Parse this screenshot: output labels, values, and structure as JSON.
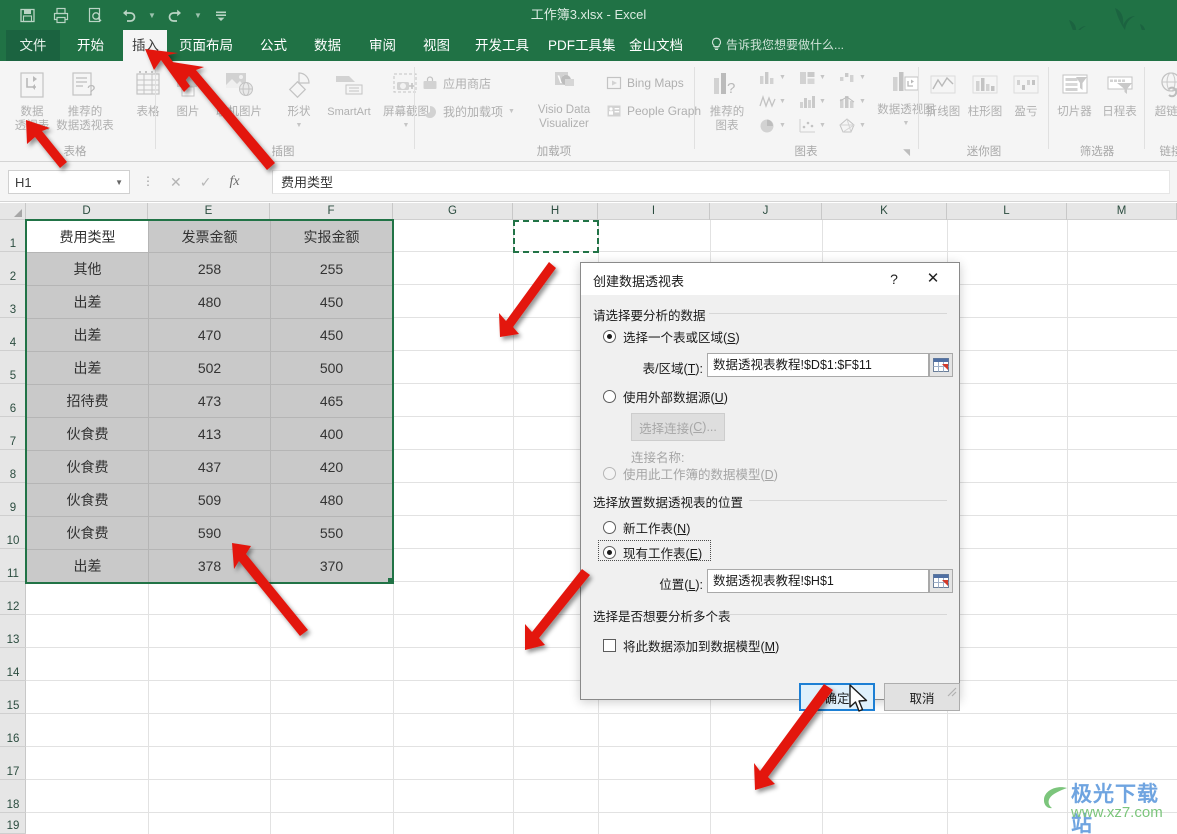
{
  "titlebar": {
    "document_title": "工作簿3.xlsx - Excel",
    "qat": [
      {
        "name": "save-icon",
        "label": "保存"
      },
      {
        "name": "print-icon",
        "label": "快速打印"
      },
      {
        "name": "print-preview-icon",
        "label": "打印预览"
      },
      {
        "name": "undo-icon",
        "label": "撤销"
      },
      {
        "name": "redo-icon",
        "label": "恢复"
      },
      {
        "name": "customize-qat-icon",
        "label": "自定义快速访问工具栏"
      }
    ]
  },
  "tabs": [
    {
      "label": "文件",
      "state": "file"
    },
    {
      "label": "开始",
      "state": "normal"
    },
    {
      "label": "插入",
      "state": "active"
    },
    {
      "label": "页面布局",
      "state": "normal"
    },
    {
      "label": "公式",
      "state": "normal"
    },
    {
      "label": "数据",
      "state": "normal"
    },
    {
      "label": "审阅",
      "state": "normal"
    },
    {
      "label": "视图",
      "state": "normal"
    },
    {
      "label": "开发工具",
      "state": "normal"
    },
    {
      "label": "PDF工具集",
      "state": "normal"
    },
    {
      "label": "金山文档",
      "state": "normal"
    }
  ],
  "tellme": {
    "text": "告诉我您想要做什么..."
  },
  "ribbon": {
    "groups": [
      {
        "title": "表格",
        "items": [
          {
            "label": "数据\n透视表",
            "line1": "数据",
            "line2": "透视表",
            "icon": "pivot-table-icon"
          },
          {
            "label": "推荐的\n数据透视表",
            "line1": "推荐的",
            "line2": "数据透视表",
            "icon": "recommended-pivot-icon"
          },
          {
            "label": "表格",
            "line1": "表格",
            "line2": "",
            "icon": "table-icon"
          }
        ]
      },
      {
        "title": "插图",
        "items": [
          {
            "line1": "图片",
            "line2": "",
            "icon": "picture-icon"
          },
          {
            "line1": "联机图片",
            "line2": "",
            "icon": "online-picture-icon"
          },
          {
            "line1": "形状",
            "line2": "",
            "icon": "shapes-icon"
          },
          {
            "line1": "SmartArt",
            "line2": "",
            "icon": "smartart-icon"
          },
          {
            "line1": "屏幕截图",
            "line2": "",
            "icon": "screenshot-icon"
          }
        ]
      },
      {
        "title": "加载项",
        "items": [
          {
            "line1": "应用商店",
            "icon": "store-icon"
          },
          {
            "line1": "我的加载项",
            "icon": "my-addins-icon"
          },
          {
            "line1": "Visio Data Visualizer",
            "icon": "visio-icon"
          },
          {
            "line1": "Bing Maps",
            "icon": "bing-maps-icon"
          },
          {
            "line1": "People Graph",
            "icon": "people-graph-icon"
          }
        ]
      },
      {
        "title": "图表",
        "items": [
          {
            "line1": "推荐的",
            "line2": "图表",
            "icon": "recommended-charts-icon"
          },
          {
            "line1": "数据透视图",
            "line2": "",
            "icon": "pivot-chart-icon"
          }
        ]
      },
      {
        "title": "迷你图",
        "items": [
          {
            "line1": "折线图",
            "icon": "sparkline-line-icon"
          },
          {
            "line1": "柱形图",
            "icon": "sparkline-column-icon"
          },
          {
            "line1": "盈亏",
            "icon": "sparkline-winloss-icon"
          }
        ]
      },
      {
        "title": "筛选器",
        "items": [
          {
            "line1": "切片器",
            "icon": "slicer-icon"
          },
          {
            "line1": "日程表",
            "icon": "timeline-icon"
          }
        ]
      },
      {
        "title": "链接",
        "items": [
          {
            "line1": "超链接",
            "icon": "hyperlink-icon"
          }
        ]
      }
    ]
  },
  "formula_bar": {
    "name_box_value": "H1",
    "cancel_label": "✕",
    "confirm_label": "✓",
    "fx_label": "fx",
    "formula_value": "费用类型"
  },
  "grid": {
    "column_headers": [
      "D",
      "E",
      "F",
      "G",
      "H",
      "I",
      "J",
      "K",
      "L",
      "M"
    ],
    "row_headers": [
      "1",
      "2",
      "3",
      "4",
      "5",
      "6",
      "7",
      "8",
      "9",
      "10",
      "11",
      "12",
      "13",
      "14",
      "15",
      "16",
      "17",
      "18",
      "19"
    ],
    "table": {
      "headers": [
        "费用类型",
        "发票金额",
        "实报金额"
      ],
      "rows": [
        [
          "其他",
          "258",
          "255"
        ],
        [
          "出差",
          "480",
          "450"
        ],
        [
          "出差",
          "470",
          "450"
        ],
        [
          "出差",
          "502",
          "500"
        ],
        [
          "招待费",
          "473",
          "465"
        ],
        [
          "伙食费",
          "413",
          "400"
        ],
        [
          "伙食费",
          "437",
          "420"
        ],
        [
          "伙食费",
          "509",
          "480"
        ],
        [
          "伙食费",
          "590",
          "550"
        ],
        [
          "出差",
          "378",
          "370"
        ]
      ]
    },
    "selected_range": "D1:F11",
    "active_cell": "H1"
  },
  "dialog": {
    "title": "创建数据透视表",
    "help_label": "?",
    "close_label": "✕",
    "section1_label": "请选择要分析的数据",
    "radio_table_range": "选择一个表或区域(S)",
    "field_table_range_label": "表/区域(T):",
    "field_table_range_value": "数据透视表教程!$D$1:$F$11",
    "radio_external": "使用外部数据源(U)",
    "btn_choose_connection": "选择连接(C)...",
    "connection_name_label": "连接名称:",
    "radio_data_model": "使用此工作簿的数据模型(D)",
    "section2_label": "选择放置数据透视表的位置",
    "radio_new_sheet": "新工作表(N)",
    "radio_existing_sheet": "现有工作表(E)",
    "field_location_label": "位置(L):",
    "field_location_value": "数据透视表教程!$H$1",
    "section3_label": "选择是否想要分析多个表",
    "checkbox_add_to_model": "将此数据添加到数据模型(M)",
    "ok_label": "确定",
    "cancel_label": "取消",
    "selected_source": "选择一个表或区域(S)",
    "selected_destination": "现有工作表(E)",
    "checkbox_checked": false
  },
  "watermark": {
    "cn": "极光下载站",
    "url": "www.xz7.com"
  },
  "colors": {
    "excel_green": "#207245",
    "ribbon_bg": "#f5f5f5",
    "selection_green": "#217346",
    "annotation_red": "#e81123",
    "dialog_bg": "#f0f0f0",
    "primary_button_border": "#1c7fd4",
    "watermark_blue": "#6fa4e0",
    "watermark_green": "#7cc57c"
  }
}
